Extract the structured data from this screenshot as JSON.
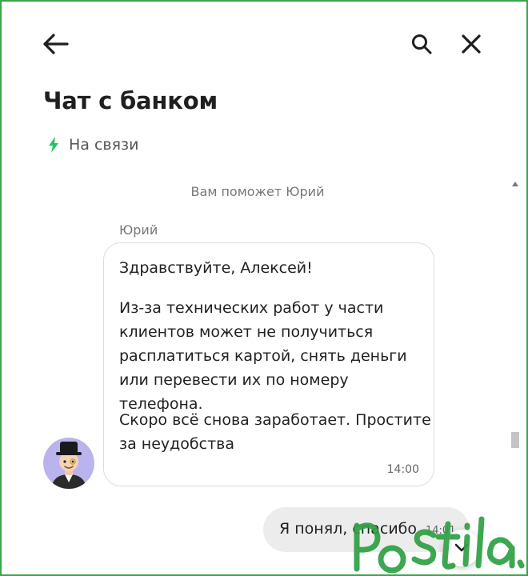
{
  "header": {
    "back_icon": "arrow-left-icon",
    "search_icon": "search-icon",
    "close_icon": "close-icon",
    "title": "Чат с банком"
  },
  "status": {
    "icon": "lightning-icon",
    "text": "На связи",
    "color": "#22c55e"
  },
  "chat": {
    "system_message": "Вам поможет Юрий",
    "incoming": {
      "sender": "Юрий",
      "paragraphs": [
        "Здравствуйте, Алексей!",
        "Из-за технических работ у части клиентов может не получиться расплатиться картой, снять деньги или перевести их по номеру телефона.",
        "Скоро всё снова заработает. Простите за неудобства"
      ],
      "time": "14:00"
    },
    "outgoing": {
      "text": "Я понял, спасибо",
      "time": "14:01"
    }
  },
  "watermark": {
    "text": "Postila.ru",
    "color": "#2ea043"
  },
  "colors": {
    "accent_green": "#22c55e",
    "frame_border": "#3aa64a",
    "outgoing_bubble": "#ececec"
  }
}
